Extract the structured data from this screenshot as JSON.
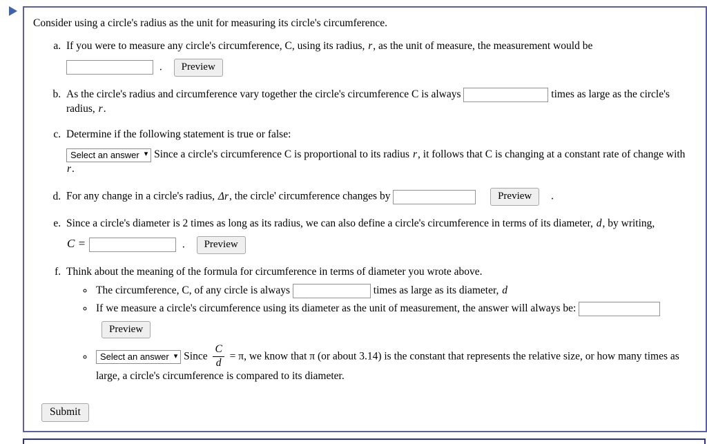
{
  "panel": {
    "marker_icon": "play-triangle-icon",
    "border_color": "#5b5ea8"
  },
  "intro": "Consider using a circle's radius as the unit for measuring its circle's circumference.",
  "items": {
    "a": {
      "text_before": "If you were to measure any circle's circumference,",
      "var_C": "C",
      "text_mid": ", using its radius,",
      "var_r": "r",
      "text_after": ", as the unit of measure, the measurement would be",
      "input_value": "",
      "input_placeholder": "",
      "period": ".",
      "preview_label": "Preview"
    },
    "b": {
      "text_before": "As the circle's radius and circumference vary together the circle's circumference",
      "var_C": "C",
      "text_mid": "is always",
      "input_value": "",
      "text_after": "times as large as the circle's radius,",
      "var_r": "r",
      "period": "."
    },
    "c": {
      "prompt": "Determine if the following statement is true or false:",
      "select_label": "Select an answer",
      "select_chevron": "chevron-down-icon",
      "text_1": "Since a circle's circumference",
      "var_C": "C",
      "text_2": "is proportional to its radius",
      "var_r": "r",
      "text_3": ", it follows that",
      "var_C2": "C",
      "text_4": "is changing at a constant rate of change with",
      "var_r2": "r",
      "period": "."
    },
    "d": {
      "text_before": "For any change in a circle's radius,",
      "var_delta_r": "Δr",
      "text_mid": ", the circle' circumference changes by",
      "input_value": "",
      "preview_label": "Preview",
      "period": "."
    },
    "e": {
      "text": "Since a circle's diameter is 2 times as long as its radius, we can also define a circle's circumference in terms of its diameter,",
      "var_d": "d",
      "text_after": ", by writing,",
      "formula_lhs": "C =",
      "input_value": "",
      "period": ".",
      "preview_label": "Preview"
    },
    "f": {
      "prompt": "Think about the meaning of the formula for circumference in terms of diameter you wrote above.",
      "bullets": [
        {
          "text_before": "The circumference,",
          "var_C": "C",
          "text_mid": ", of any circle is always",
          "input_value": "",
          "text_after": "times as large as its diameter,",
          "var_d": "d"
        },
        {
          "text_before": "If we measure a circle's circumference using its diameter as the unit of measurement, the answer will always be:",
          "input_value": "",
          "preview_label": "Preview"
        },
        {
          "select_label": "Select an answer",
          "select_chevron": "chevron-down-icon",
          "text_1": "Since",
          "frac_num": "C",
          "frac_den": "d",
          "text_2": "= π, we know that π (or about 3.14) is the constant that represents the relative size, or how many times as large, a circle's circumference is compared to its diameter."
        }
      ]
    }
  },
  "submit": {
    "label": "Submit"
  }
}
